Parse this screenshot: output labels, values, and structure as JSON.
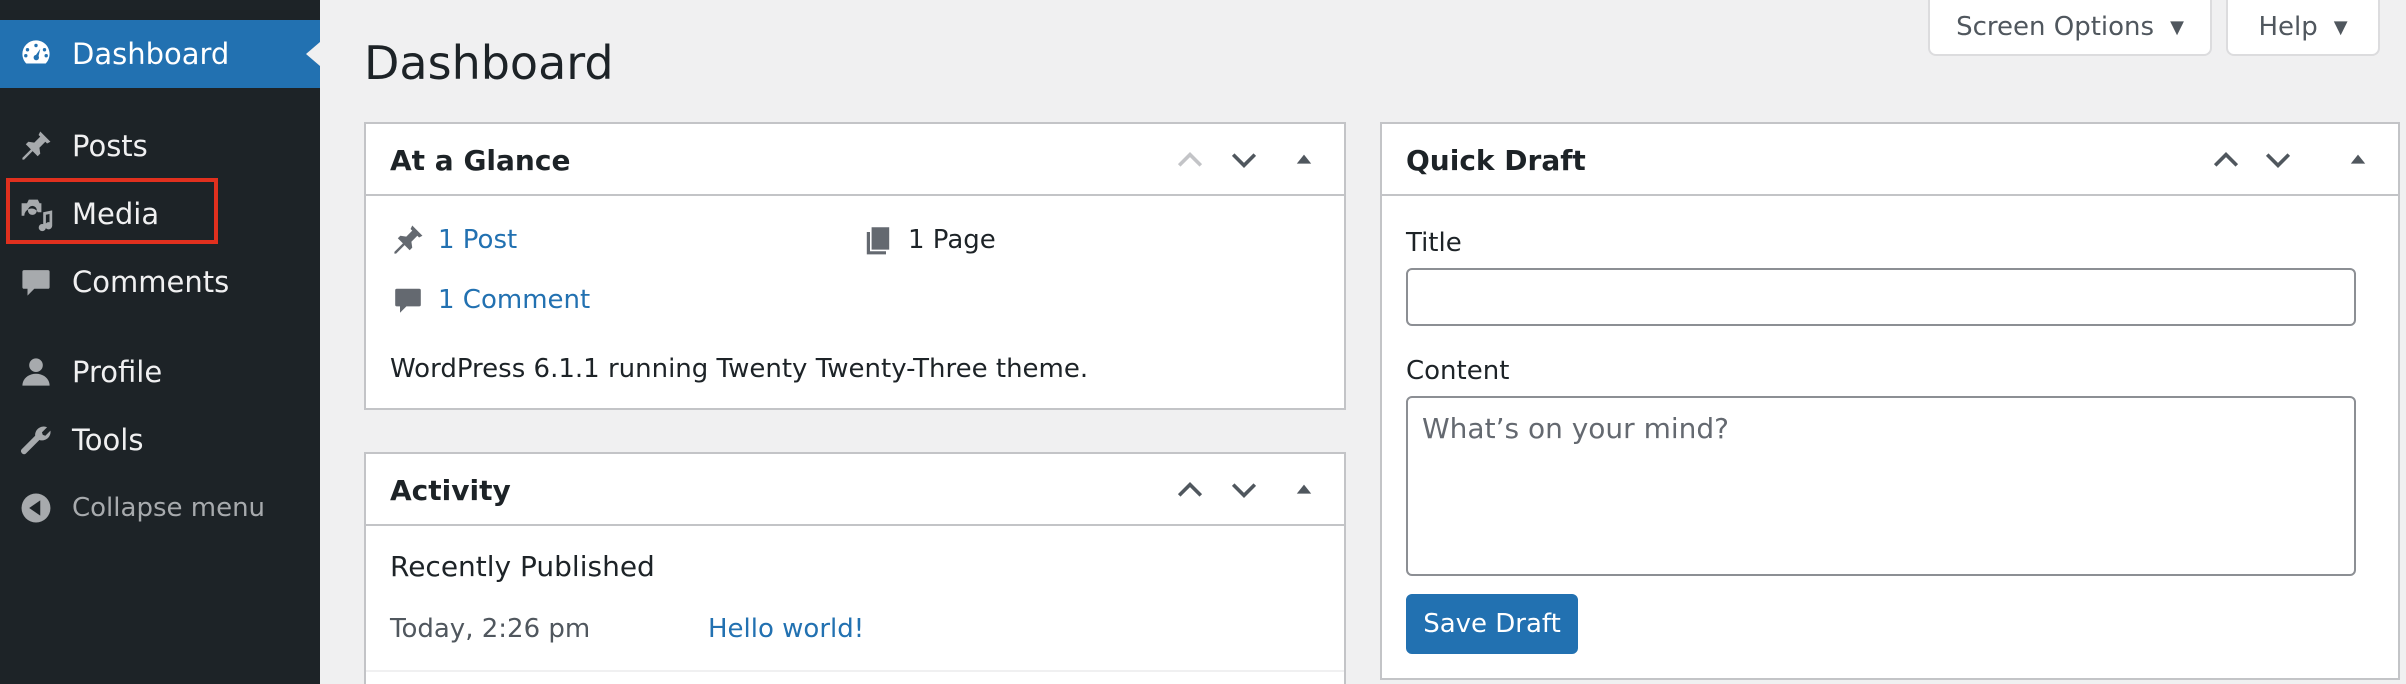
{
  "sidebar": {
    "items": [
      {
        "label": "Dashboard",
        "icon": "dashboard-icon",
        "active": true
      },
      {
        "label": "Posts",
        "icon": "pin-icon"
      },
      {
        "label": "Media",
        "icon": "media-icon"
      },
      {
        "label": "Comments",
        "icon": "comment-icon"
      },
      {
        "label": "Profile",
        "icon": "user-icon"
      },
      {
        "label": "Tools",
        "icon": "wrench-icon"
      }
    ],
    "collapse_label": "Collapse menu"
  },
  "toolbar": {
    "screen_options_label": "Screen Options",
    "help_label": "Help"
  },
  "page": {
    "title": "Dashboard"
  },
  "at_a_glance": {
    "title": "At a Glance",
    "posts_link": "1 Post",
    "pages_text": "1 Page",
    "comments_link": "1 Comment",
    "version_text": "WordPress 6.1.1 running Twenty Twenty-Three theme."
  },
  "activity": {
    "title": "Activity",
    "section_heading": "Recently Published",
    "items": [
      {
        "date": "Today, 2:26 pm",
        "post_title": "Hello world!"
      }
    ]
  },
  "quick_draft": {
    "title": "Quick Draft",
    "title_label": "Title",
    "title_value": "",
    "content_label": "Content",
    "content_placeholder": "What’s on your mind?",
    "save_label": "Save Draft"
  },
  "colors": {
    "sidebar_bg": "#1d2327",
    "accent": "#2271b1",
    "highlight": "#e0301e"
  }
}
